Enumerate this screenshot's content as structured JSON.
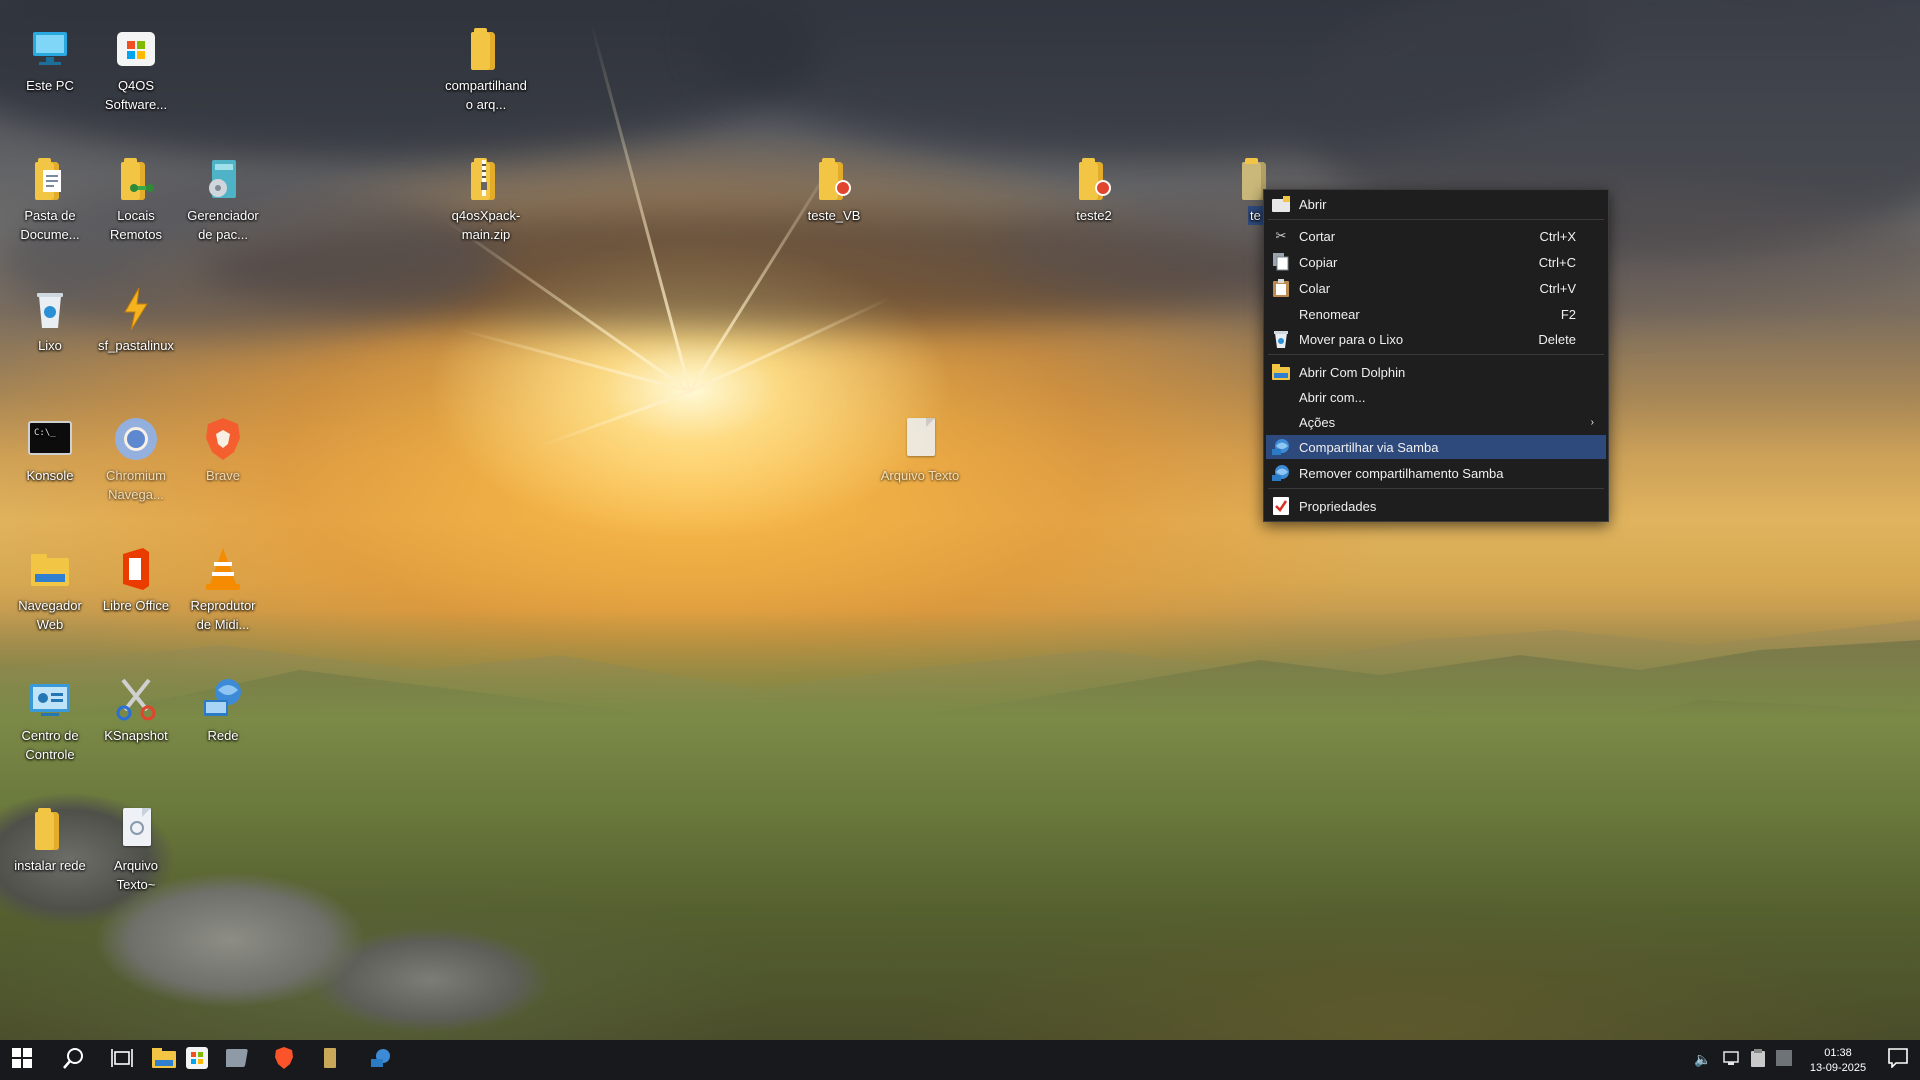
{
  "desktop": {
    "icons": [
      {
        "label": "Este PC",
        "icon": "computer-icon"
      },
      {
        "label": "Q4OS Software...",
        "icon": "software-store-icon"
      },
      {
        "label": "compartilhando arq...",
        "icon": "folder-icon"
      },
      {
        "label": "Pasta de Docume...",
        "icon": "documents-folder-icon"
      },
      {
        "label": "Locais Remotos",
        "icon": "remote-folder-icon"
      },
      {
        "label": "Gerenciador de pac...",
        "icon": "package-manager-icon"
      },
      {
        "label": "q4osXpack-main.zip",
        "icon": "zip-archive-icon"
      },
      {
        "label": "teste_VB",
        "icon": "shared-folder-icon"
      },
      {
        "label": "teste2",
        "icon": "shared-folder-icon"
      },
      {
        "label": "te",
        "icon": "folder-icon"
      },
      {
        "label": "Lixo",
        "icon": "trash-icon"
      },
      {
        "label": "sf_pastalinux",
        "icon": "bolt-folder-icon"
      },
      {
        "label": "Konsole",
        "icon": "terminal-icon"
      },
      {
        "label": "Chromium Navega...",
        "icon": "chromium-icon"
      },
      {
        "label": "Brave",
        "icon": "brave-icon"
      },
      {
        "label": "Arquivo Texto",
        "icon": "text-file-icon"
      },
      {
        "label": "Navegador Web",
        "icon": "web-browser-icon"
      },
      {
        "label": "Libre Office",
        "icon": "libreoffice-icon"
      },
      {
        "label": "Reprodutor de Midi...",
        "icon": "vlc-icon"
      },
      {
        "label": "Centro de Controle",
        "icon": "control-center-icon"
      },
      {
        "label": "KSnapshot",
        "icon": "ksnapshot-icon"
      },
      {
        "label": "Rede",
        "icon": "network-icon"
      },
      {
        "label": "instalar rede",
        "icon": "folder-icon"
      },
      {
        "label": "Arquivo Texto~",
        "icon": "text-file-icon"
      }
    ]
  },
  "context_menu": {
    "items": [
      {
        "label": "Abrir",
        "shortcut": "",
        "icon": "open-folder-icon"
      },
      {
        "label": "Cortar",
        "shortcut": "Ctrl+X",
        "icon": "scissors-icon"
      },
      {
        "label": "Copiar",
        "shortcut": "Ctrl+C",
        "icon": "copy-icon"
      },
      {
        "label": "Colar",
        "shortcut": "Ctrl+V",
        "icon": "paste-icon"
      },
      {
        "label": "Renomear",
        "shortcut": "F2",
        "icon": ""
      },
      {
        "label": "Mover para o Lixo",
        "shortcut": "Delete",
        "icon": "trash-icon"
      },
      {
        "label": "Abrir Com Dolphin",
        "shortcut": "",
        "icon": "dolphin-icon"
      },
      {
        "label": "Abrir com...",
        "shortcut": "",
        "icon": ""
      },
      {
        "label": "Ações",
        "shortcut": "",
        "icon": "",
        "submenu_glyph": "›"
      },
      {
        "label": "Compartilhar via Samba",
        "shortcut": "",
        "icon": "samba-share-icon",
        "selected": true
      },
      {
        "label": "Remover compartilhamento Samba",
        "shortcut": "",
        "icon": "samba-unshare-icon"
      },
      {
        "label": "Propriedades",
        "shortcut": "",
        "icon": "properties-icon"
      }
    ]
  },
  "taskbar": {
    "clock_time": "01:38",
    "clock_date": "13-09-2025",
    "apps": [
      "start-icon",
      "search-icon",
      "task-view-icon",
      "file-manager-icon",
      "software-store-icon",
      "window-icon",
      "brave-icon",
      "folder-icon",
      "network-icon"
    ],
    "tray": [
      "volume-icon",
      "network-icon",
      "clipboard-icon",
      "storage-icon"
    ],
    "accent": "#2e4a7d"
  }
}
